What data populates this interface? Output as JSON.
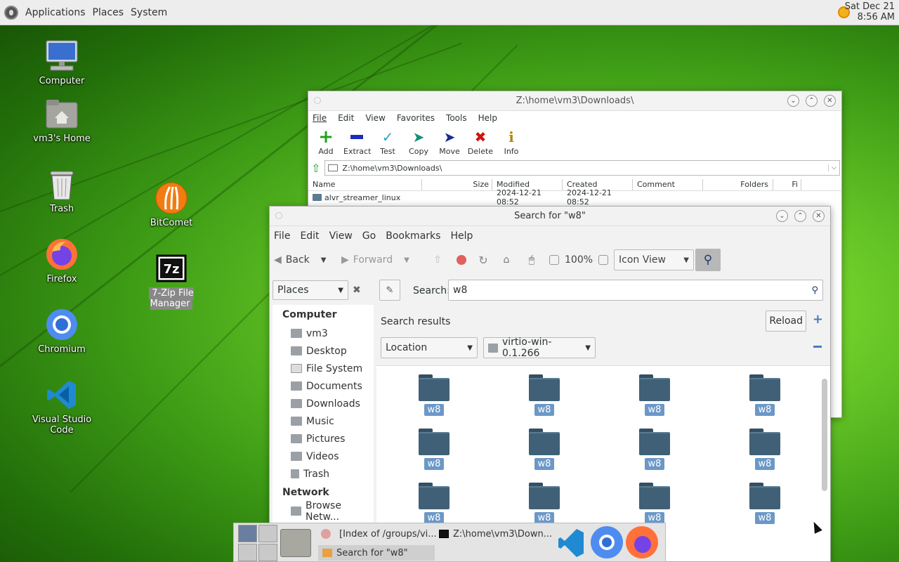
{
  "top_panel": {
    "menus": [
      "Applications",
      "Places",
      "System"
    ],
    "clock_line1": "Sat Dec 21",
    "clock_line2": "8:56 AM"
  },
  "desktop_icons": [
    {
      "label": "Computer",
      "icon": "computer-icon"
    },
    {
      "label": "vm3's Home",
      "icon": "home-folder-icon"
    },
    {
      "label": "Trash",
      "icon": "trash-icon"
    },
    {
      "label": "Firefox",
      "icon": "firefox-icon"
    },
    {
      "label": "Chromium",
      "icon": "chromium-icon"
    },
    {
      "label": "Visual Studio Code",
      "icon": "vscode-icon"
    },
    {
      "label": "BitComet",
      "icon": "bitcomet-icon"
    },
    {
      "label": "7-Zip File Manager",
      "icon": "7zip-icon"
    }
  ],
  "zip_window": {
    "title": "Z:\\home\\vm3\\Downloads\\",
    "menus": [
      "File",
      "Edit",
      "View",
      "Favorites",
      "Tools",
      "Help"
    ],
    "tools": [
      "Add",
      "Extract",
      "Test",
      "Copy",
      "Move",
      "Delete",
      "Info"
    ],
    "address": "Z:\\home\\vm3\\Downloads\\",
    "columns": [
      "Name",
      "Size",
      "Modified",
      "Created",
      "Comment",
      "Folders",
      "Fi"
    ],
    "rows": [
      {
        "name": "alvr_streamer_linux",
        "size": "",
        "modified": "2024-12-21 08:52",
        "created": "2024-12-21 08:52"
      }
    ]
  },
  "search_window": {
    "title": "Search for \"w8\"",
    "menus": [
      "File",
      "Edit",
      "View",
      "Go",
      "Bookmarks",
      "Help"
    ],
    "back_label": "Back",
    "forward_label": "Forward",
    "zoom": "100%",
    "view_mode": "Icon View",
    "places_label": "Places",
    "search_label": "Search:",
    "search_value": "w8",
    "results_label": "Search results",
    "reload_label": "Reload",
    "location_label": "Location",
    "location_value": "virtio-win-0.1.266",
    "sidebar": {
      "computer_header": "Computer",
      "computer_items": [
        "vm3",
        "Desktop",
        "File System",
        "Documents",
        "Downloads",
        "Music",
        "Pictures",
        "Videos",
        "Trash"
      ],
      "network_header": "Network",
      "network_items": [
        "Browse Netw..."
      ]
    },
    "results": [
      "w8",
      "w8",
      "w8",
      "w8",
      "w8",
      "w8",
      "w8",
      "w8",
      "w8",
      "w8",
      "w8",
      "w8"
    ]
  },
  "taskbar": {
    "tasks": [
      "[Index of /groups/vi...",
      "Z:\\home\\vm3\\Down...",
      "Search for \"w8\""
    ]
  }
}
